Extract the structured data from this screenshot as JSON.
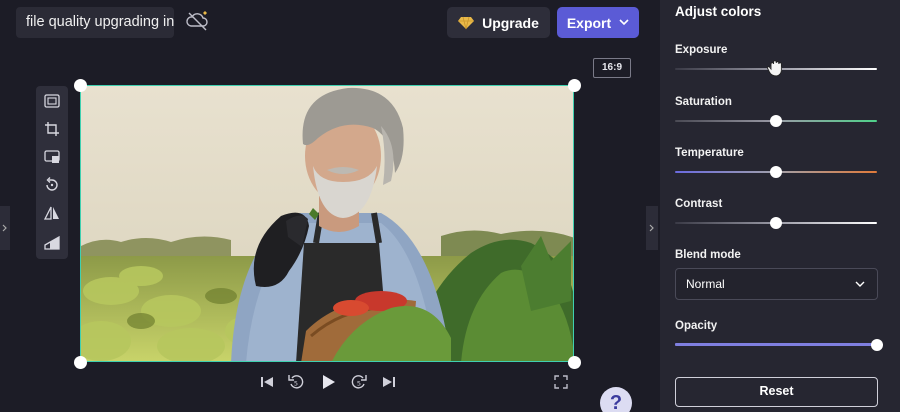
{
  "header": {
    "project_title": "file quality upgrading in",
    "upgrade_label": "Upgrade",
    "export_label": "Export",
    "aspect_ratio": "16:9"
  },
  "icons": {
    "cloud": "cloud-offline-icon",
    "upgrade": "diamond-icon",
    "export": "chevron-down-icon",
    "toolbar": [
      "fit-icon",
      "crop-icon",
      "picture-in-picture-icon",
      "rotate-icon",
      "flip-icon",
      "perspective-icon"
    ],
    "playback": [
      "skip-back-icon",
      "rewind-5-icon",
      "play-icon",
      "forward-5-icon",
      "skip-forward-icon",
      "fullscreen-icon"
    ]
  },
  "panel": {
    "title": "Adjust colors",
    "sliders": [
      {
        "label": "Exposure",
        "value": 0.5
      },
      {
        "label": "Saturation",
        "value": 0.5
      },
      {
        "label": "Temperature",
        "value": 0.5
      },
      {
        "label": "Contrast",
        "value": 0.5
      }
    ],
    "blend_mode": {
      "label": "Blend mode",
      "value": "Normal"
    },
    "opacity": {
      "label": "Opacity",
      "value": 1.0
    },
    "reset_label": "Reset"
  },
  "help": {
    "label": "?"
  },
  "colors": {
    "accent": "#5b5bd6",
    "selection": "#3fd0b0",
    "saturation_track": "#4fd18a",
    "temperature_left": "#6a6adf",
    "temperature_right": "#e07a3a",
    "opacity_track": "#7f7fe0"
  }
}
